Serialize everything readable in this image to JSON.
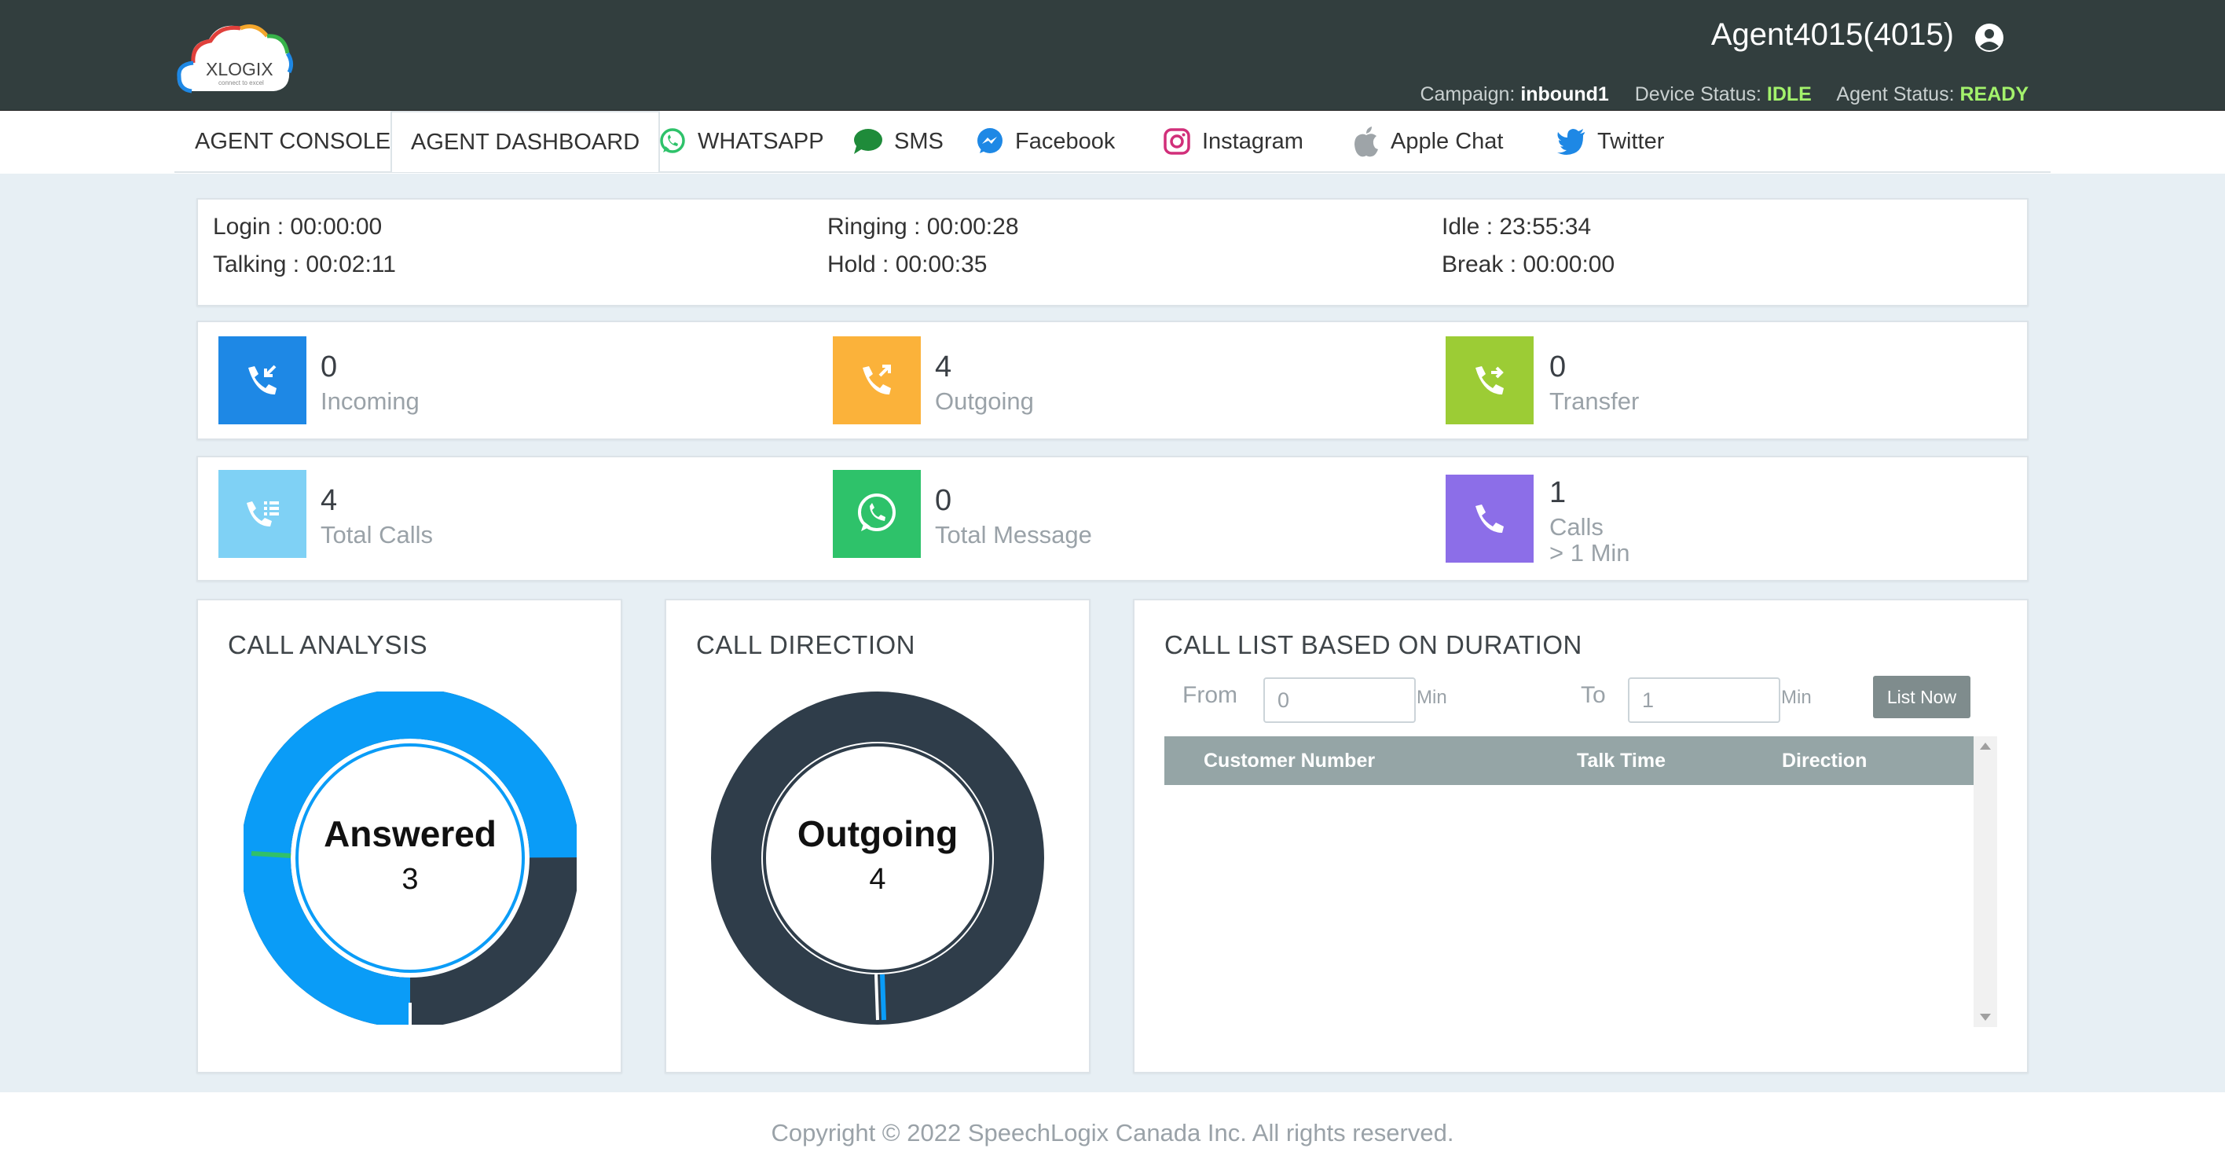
{
  "header": {
    "logo_text": "XLOGIX",
    "logo_tagline": "connect to excel",
    "agent_name": "Agent4015(4015)",
    "campaign_label": "Campaign:",
    "campaign_value": "inbound1",
    "device_status_label": "Device Status:",
    "device_status_value": "IDLE",
    "agent_status_label": "Agent Status:",
    "agent_status_value": "READY"
  },
  "nav": {
    "items": [
      {
        "label": "AGENT CONSOLE",
        "icon": "none"
      },
      {
        "label": "AGENT DASHBOARD",
        "icon": "none",
        "active": true
      },
      {
        "label": "WHATSAPP",
        "icon": "whatsapp-icon"
      },
      {
        "label": "SMS",
        "icon": "sms-icon"
      },
      {
        "label": "Facebook",
        "icon": "messenger-icon"
      },
      {
        "label": "Instagram",
        "icon": "instagram-icon"
      },
      {
        "label": "Apple Chat",
        "icon": "apple-icon"
      },
      {
        "label": "Twitter",
        "icon": "twitter-icon"
      }
    ]
  },
  "timers": {
    "login": "Login : 00:00:00",
    "talking": "Talking : 00:02:11",
    "ringing": "Ringing : 00:00:28",
    "hold": "Hold : 00:00:35",
    "idle": "Idle : 23:55:34",
    "break": "Break : 00:00:00"
  },
  "stats": {
    "incoming": {
      "value": "0",
      "label": "Incoming",
      "color": "#1e88e5"
    },
    "outgoing": {
      "value": "4",
      "label": "Outgoing",
      "color": "#fbb23a"
    },
    "transfer": {
      "value": "0",
      "label": "Transfer",
      "color": "#9ccc35"
    },
    "total_calls": {
      "value": "4",
      "label": "Total Calls",
      "color": "#7fd1f5"
    },
    "total_message": {
      "value": "0",
      "label": "Total Message",
      "color": "#2ec26a"
    },
    "calls_1min": {
      "value": "1",
      "label_line1": "Calls",
      "label_line2": "> 1 Min",
      "color": "#8c6ee8"
    }
  },
  "call_analysis": {
    "title": "CALL ANALYSIS",
    "center_label": "Answered",
    "center_value": "3",
    "segments": [
      {
        "name": "answered",
        "fraction": 0.75,
        "color": "#0a9cf7"
      },
      {
        "name": "dark",
        "fraction": 0.24,
        "color": "#2f3d4a"
      },
      {
        "name": "green",
        "fraction": 0.01,
        "color": "#31c06a"
      }
    ]
  },
  "call_direction": {
    "title": "CALL DIRECTION",
    "center_label": "Outgoing",
    "center_value": "4",
    "segments": [
      {
        "name": "outgoing",
        "fraction": 0.99,
        "color": "#2f3d4a"
      },
      {
        "name": "incoming",
        "fraction": 0.01,
        "color": "#0a9cf7"
      }
    ]
  },
  "call_list": {
    "title": "CALL LIST BASED ON DURATION",
    "from_label": "From",
    "from_value": "0",
    "to_label": "To",
    "to_value": "1",
    "unit": "Min",
    "button_label": "List Now",
    "columns": [
      "Customer Number",
      "Talk Time",
      "Direction"
    ]
  },
  "footer": {
    "text": "Copyright © 2022 SpeechLogix Canada Inc. All rights reserved."
  }
}
